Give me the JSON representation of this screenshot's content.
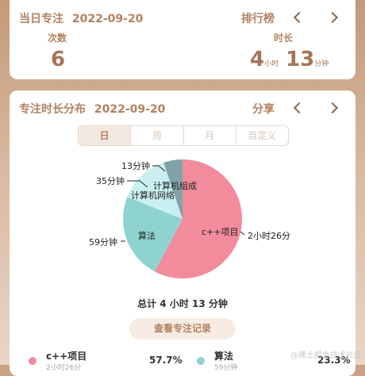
{
  "today": {
    "title": "当日专注",
    "date": "2022-09-20",
    "ranking_label": "排行榜",
    "count_label": "次数",
    "count_value": "6",
    "duration_label": "时长",
    "hours_value": "4",
    "hours_unit": "小时",
    "minutes_value": "13",
    "minutes_unit": "分钟"
  },
  "distribution": {
    "title": "专注时长分布",
    "date": "2022-09-20",
    "share_label": "分享",
    "tabs": [
      "日",
      "周",
      "月",
      "自定义"
    ],
    "total_text": "总计 4 小时 13 分钟",
    "view_button": "查看专注记录"
  },
  "chart_data": {
    "type": "pie",
    "title": "",
    "slices": [
      {
        "name": "c++项目",
        "minutes": 146,
        "label": "2小时26分",
        "color": "#f28b9c"
      },
      {
        "name": "算法",
        "minutes": 59,
        "label": "59分钟",
        "color": "#8fd3d0"
      },
      {
        "name": "计算机网络",
        "minutes": 35,
        "label": "35分钟",
        "color": "#c9eff0"
      },
      {
        "name": "计算机组成",
        "minutes": 13,
        "label": "13分钟",
        "color": "#7fa2a6"
      }
    ]
  },
  "legend": [
    {
      "name": "c++项目",
      "percent": "57.7%",
      "sub": "2小时26分",
      "color": "#f28b9c"
    },
    {
      "name": "算法",
      "percent": "23.3%",
      "sub": "59分钟",
      "color": "#8fd3d0"
    }
  ],
  "watermark": "@稀土掘金技术社区"
}
